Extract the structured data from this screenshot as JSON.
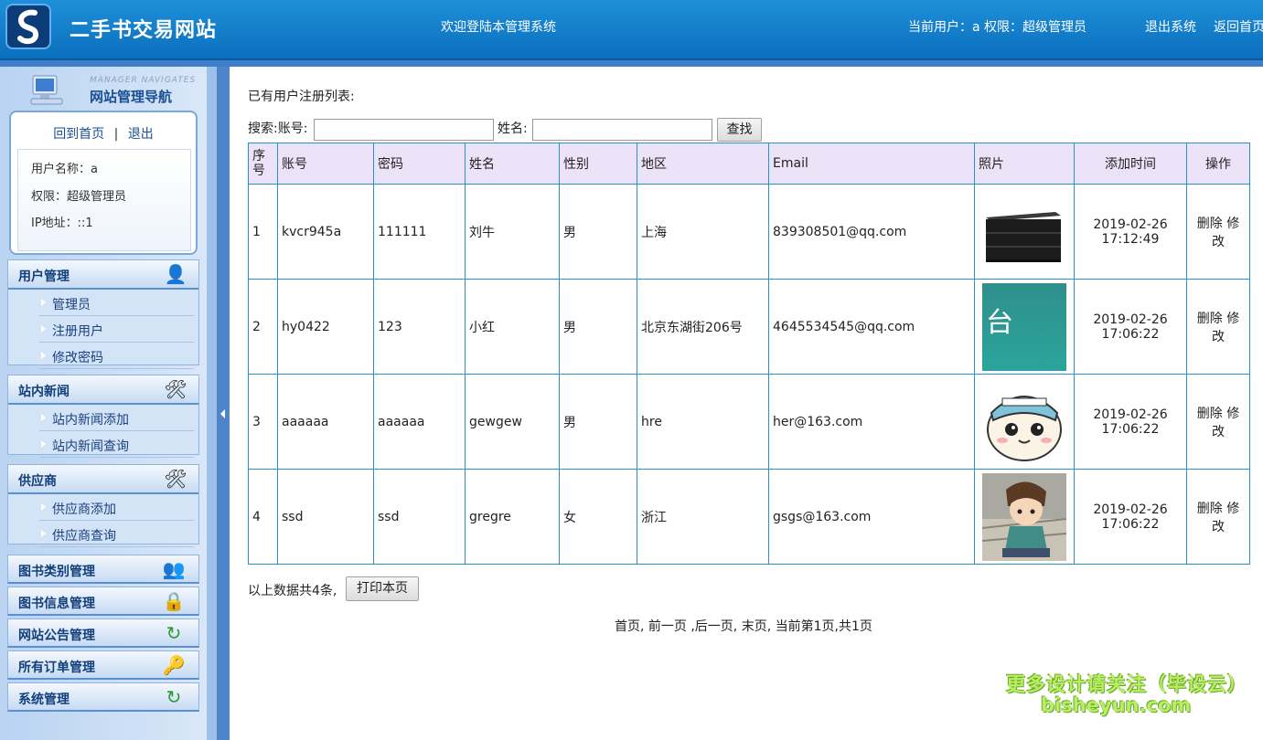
{
  "header": {
    "site_title": "二手书交易网站",
    "welcome": "欢迎登陆本管理系统",
    "user_info": "当前用户：a 权限：超级管理员",
    "logout": "退出系统",
    "home": "返回首页"
  },
  "sidebar": {
    "nav_en": "MANAGER NAVIGATES",
    "nav_cn": "网站管理导航",
    "home_link": "回到首页",
    "sep": "|",
    "logout_link": "退出",
    "username": "用户名称：a",
    "role": "权限：超级管理员",
    "ip": "IP地址：::1",
    "sections": [
      {
        "title": "用户管理",
        "icon": "user-icon",
        "items": [
          "管理员",
          "注册用户",
          "修改密码"
        ]
      },
      {
        "title": "站内新闻",
        "icon": "tools-icon",
        "items": [
          "站内新闻添加",
          "站内新闻查询"
        ]
      },
      {
        "title": "供应商",
        "icon": "tools-icon",
        "items": [
          "供应商添加",
          "供应商查询"
        ]
      }
    ],
    "singles": [
      {
        "title": "图书类别管理",
        "icon": "users-icon"
      },
      {
        "title": "图书信息管理",
        "icon": "lock-icon"
      },
      {
        "title": "网站公告管理",
        "icon": "refresh-icon"
      },
      {
        "title": "所有订单管理",
        "icon": "key-icon"
      },
      {
        "title": "系统管理",
        "icon": "refresh-icon"
      }
    ]
  },
  "main": {
    "list_title": "已有用户注册列表:",
    "search_account_label": "搜索:账号:",
    "search_name_label": "姓名:",
    "search_account_value": "",
    "search_name_value": "",
    "search_button": "查找",
    "columns": [
      "序号",
      "账号",
      "密码",
      "姓名",
      "性别",
      "地区",
      "Email",
      "照片",
      "添加时间",
      "操作"
    ],
    "rows": [
      {
        "no": "1",
        "account": "kvcr945a",
        "password": "111111",
        "name": "刘牛",
        "gender": "男",
        "region": "上海",
        "email": "839308501@qq.com",
        "photo": "dresser",
        "date": "2019-02-26",
        "time": "17:12:49"
      },
      {
        "no": "2",
        "account": "hy0422",
        "password": "123",
        "name": "小红",
        "gender": "男",
        "region": "北京东湖街206号",
        "email": "4645534545@qq.com",
        "photo": "tai",
        "date": "2019-02-26",
        "time": "17:06:22"
      },
      {
        "no": "3",
        "account": "aaaaaa",
        "password": "aaaaaa",
        "name": "gewgew",
        "gender": "男",
        "region": "hre",
        "email": "her@163.com",
        "photo": "cartoon-cat",
        "date": "2019-02-26",
        "time": "17:06:22"
      },
      {
        "no": "4",
        "account": "ssd",
        "password": "ssd",
        "name": "gregre",
        "gender": "女",
        "region": "浙江",
        "email": "gsgs@163.com",
        "photo": "cartoon-boy",
        "date": "2019-02-26",
        "time": "17:06:22"
      }
    ],
    "op_delete": "删除",
    "op_edit": "修改",
    "photo_text_tai": "台",
    "count_text": "以上数据共4条,",
    "print_button": "打印本页",
    "pager": {
      "first": "首页,",
      "prev": "前一页",
      "next": ",后一页,",
      "last": "末页,",
      "status": "当前第1页,共1页"
    }
  },
  "watermark": {
    "line1": "更多设计请关注（毕设云）",
    "line2": "bisheyun.com"
  }
}
